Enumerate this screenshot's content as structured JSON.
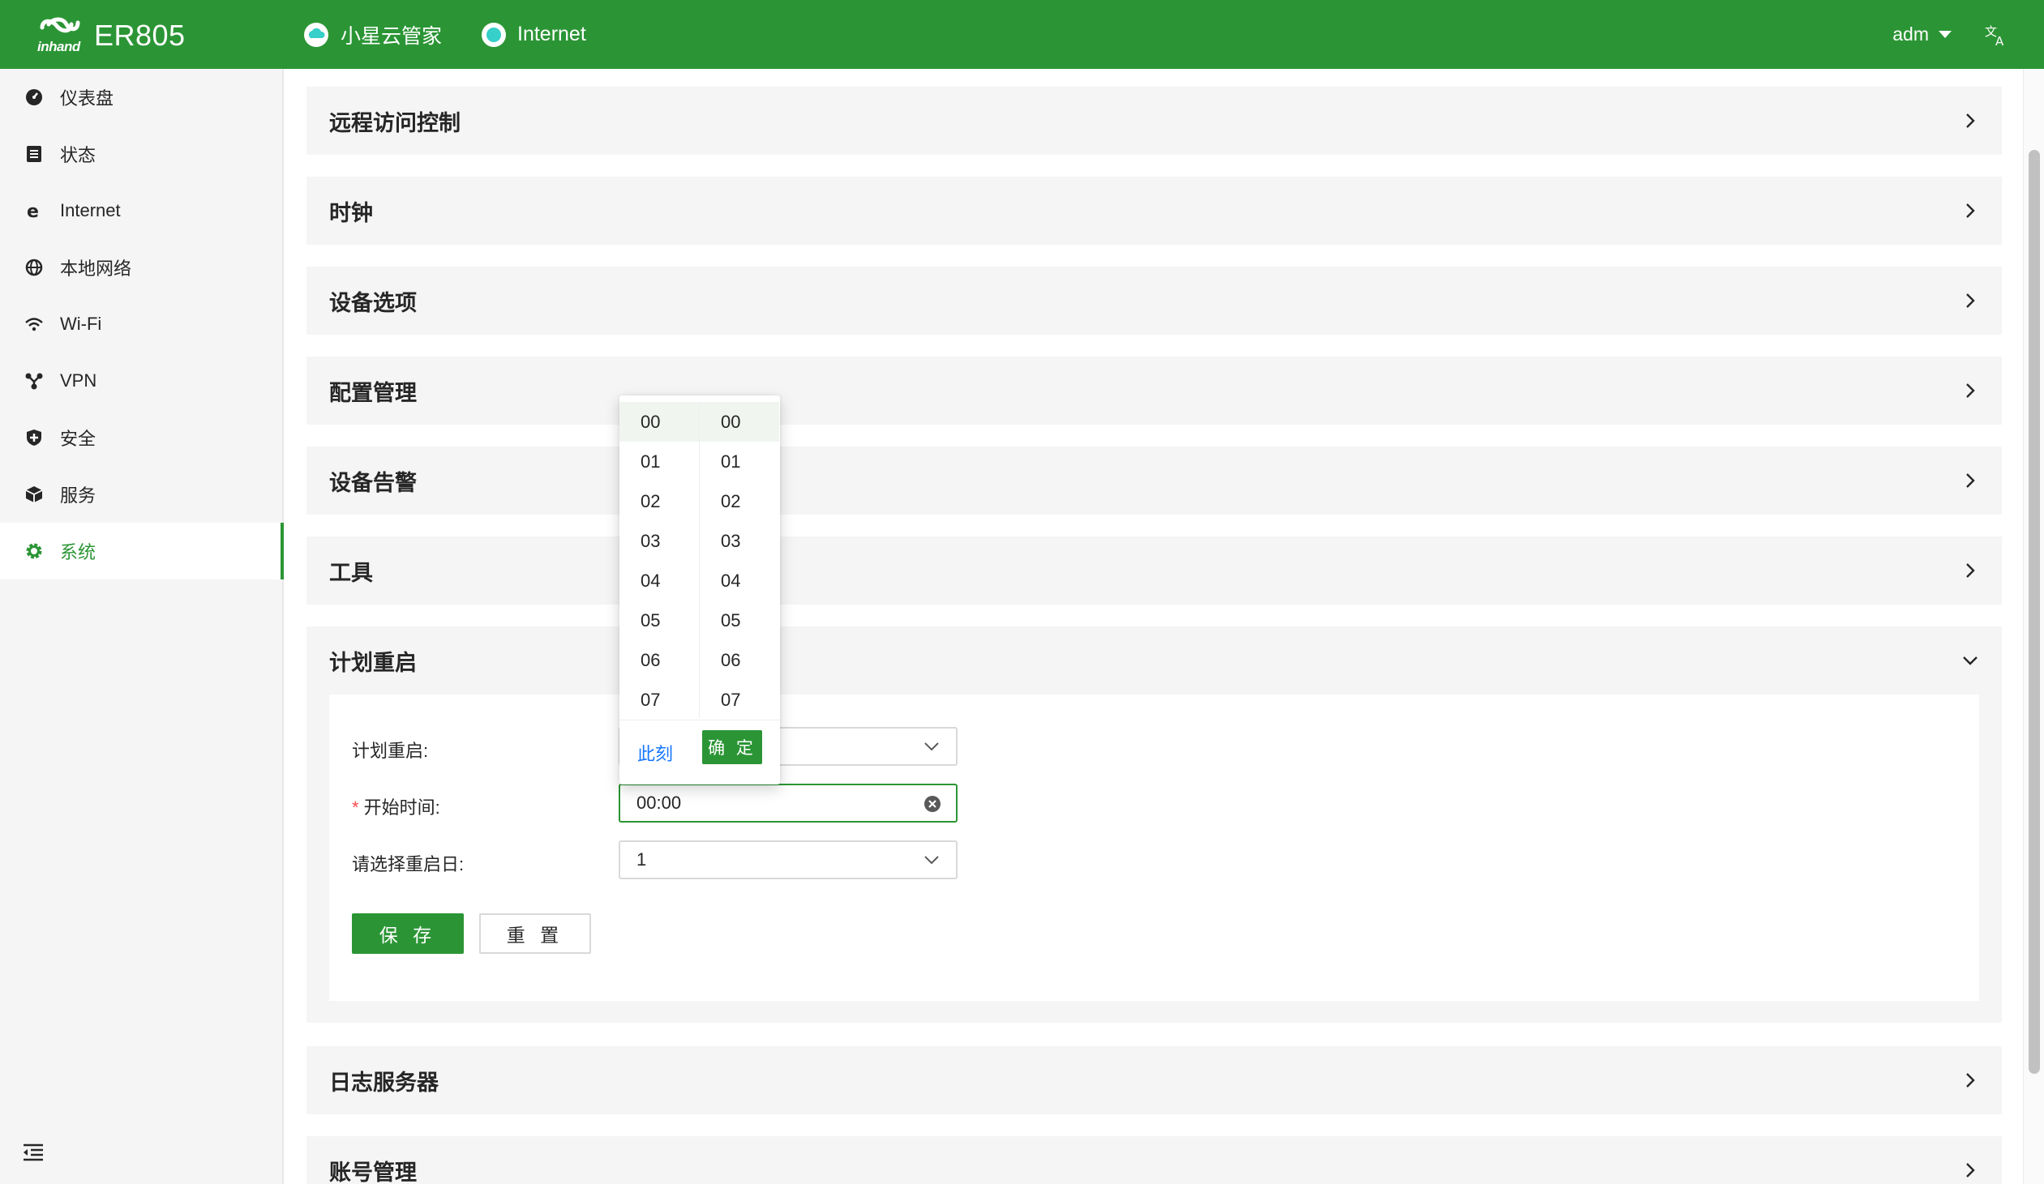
{
  "header": {
    "brand": "inhand",
    "model": "ER805",
    "cloud_label": "小星云管家",
    "internet_label": "Internet",
    "user": "adm",
    "colors": {
      "primary": "#2b9535",
      "status_dot": "#36cfc9"
    }
  },
  "sidebar": {
    "items": [
      {
        "label": "仪表盘",
        "icon": "dashboard-icon"
      },
      {
        "label": "状态",
        "icon": "status-list-icon"
      },
      {
        "label": "Internet",
        "icon": "internet-explorer-icon"
      },
      {
        "label": "本地网络",
        "icon": "globe-icon"
      },
      {
        "label": "Wi-Fi",
        "icon": "wifi-icon"
      },
      {
        "label": "VPN",
        "icon": "vpn-nodes-icon"
      },
      {
        "label": "安全",
        "icon": "shield-icon"
      },
      {
        "label": "服务",
        "icon": "cube-icon"
      },
      {
        "label": "系统",
        "icon": "gear-icon",
        "active": true
      }
    ],
    "collapse_icon": "menu-fold-icon"
  },
  "panels": {
    "remote_access": "远程访问控制",
    "clock": "时钟",
    "device_options": "设备选项",
    "config_mgmt": "配置管理",
    "device_alarm": "设备告警",
    "tools": "工具",
    "scheduled_reboot": "计划重启",
    "log_server": "日志服务器",
    "account_mgmt": "账号管理"
  },
  "reboot_form": {
    "schedule_label": "计划重启:",
    "start_time_label": "开始时间:",
    "start_time_value": "00:00",
    "day_label": "请选择重启日:",
    "day_value": "1",
    "save_label": "保 存",
    "reset_label": "重 置"
  },
  "time_picker": {
    "hours": [
      "00",
      "01",
      "02",
      "03",
      "04",
      "05",
      "06",
      "07"
    ],
    "minutes": [
      "00",
      "01",
      "02",
      "03",
      "04",
      "05",
      "06",
      "07"
    ],
    "selected_hour": "00",
    "selected_minute": "00",
    "now_label": "此刻",
    "ok_label": "确 定"
  }
}
